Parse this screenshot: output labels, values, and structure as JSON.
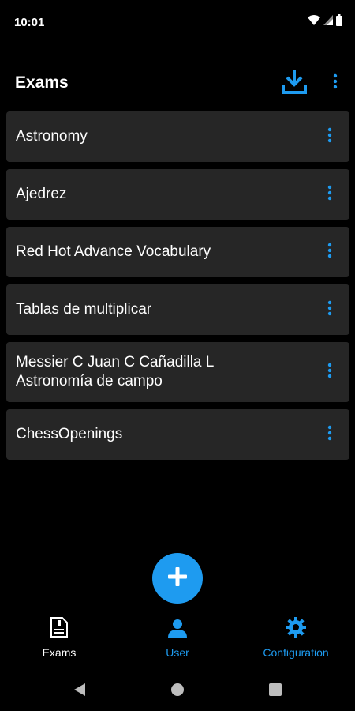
{
  "status_bar": {
    "time": "10:01",
    "icons": [
      "wifi-icon",
      "signal-icon",
      "battery-icon"
    ]
  },
  "app_bar": {
    "title": "Exams",
    "actions": [
      "download-icon",
      "more-vert-icon"
    ]
  },
  "exams": [
    {
      "title": "Astronomy"
    },
    {
      "title": "Ajedrez"
    },
    {
      "title": "Red Hot Advance Vocabulary"
    },
    {
      "title": "Tablas de multiplicar"
    },
    {
      "title": "Messier C Juan C Cañadilla L\nAstronomía de campo"
    },
    {
      "title": "ChessOpenings"
    }
  ],
  "fab": {
    "icon": "plus-icon"
  },
  "bottom_nav": {
    "items": [
      {
        "label": "Exams",
        "icon": "exam-document-icon",
        "active": true
      },
      {
        "label": "User",
        "icon": "user-icon",
        "active": false
      },
      {
        "label": "Configuration",
        "icon": "gear-icon",
        "active": false
      }
    ]
  },
  "system_nav": [
    "back-icon",
    "home-icon",
    "recents-icon"
  ],
  "colors": {
    "background": "#000000",
    "card": "#262626",
    "accent": "#1e9bf0",
    "text": "#ffffff"
  }
}
